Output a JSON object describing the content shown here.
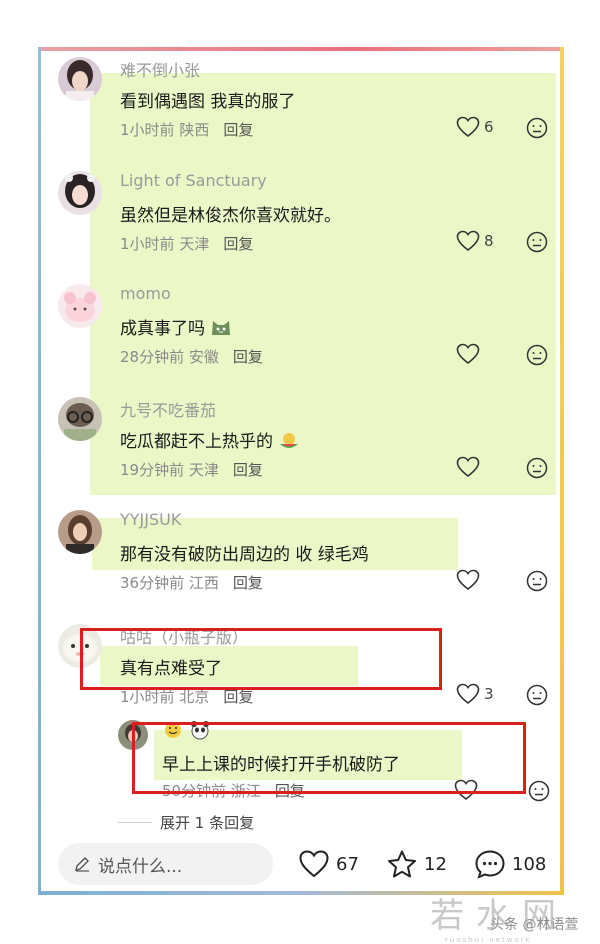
{
  "colors": {
    "highlight": "#ecf7c8",
    "annotation_red": "#d9201e",
    "frame_top": "#e86f7d",
    "frame_left": "#7ab2cf",
    "frame_right": "#f1c24a"
  },
  "comments": [
    {
      "username": "难不倒小张",
      "text": "看到偶遇图 我真的服了",
      "time": "1小时前",
      "location": "陕西",
      "reply_label": "回复",
      "likes": "6"
    },
    {
      "username": "Light of Sanctuary",
      "text": "虽然但是林俊杰你喜欢就好。",
      "time": "1小时前",
      "location": "天津",
      "reply_label": "回复",
      "likes": "8"
    },
    {
      "username": "momo",
      "text": "成真事了吗",
      "time": "28分钟前",
      "location": "安徽",
      "reply_label": "回复",
      "likes": ""
    },
    {
      "username": "九号不吃番茄",
      "text": "吃瓜都赶不上热乎的",
      "time": "19分钟前",
      "location": "天津",
      "reply_label": "回复",
      "likes": ""
    },
    {
      "username": "YYJJSUK",
      "text": "那有没有破防出周边的 收 绿毛鸡",
      "time": "36分钟前",
      "location": "江西",
      "reply_label": "回复",
      "likes": ""
    },
    {
      "username": "咕咕（小瓶子版）",
      "text": "真有点难受了",
      "time": "1小时前",
      "location": "北京",
      "reply_label": "回复",
      "likes": "3"
    }
  ],
  "subreply": {
    "text": "早上上课的时候打开手机破防了",
    "time": "50分钟前",
    "location": "浙江",
    "reply_label": "回复"
  },
  "expand_label": "展开 1 条回复",
  "bottom_bar": {
    "placeholder": "说点什么...",
    "likes": "67",
    "stars": "12",
    "comments": "108"
  },
  "watermark": {
    "site": "若水网",
    "credit": "头条 @林语萱",
    "sub": "ruoshui network"
  },
  "icons": {
    "like": "heart-outline-icon",
    "dislike": "neutral-face-icon",
    "edit": "pencil-icon",
    "star": "star-outline-icon",
    "comment": "chat-bubble-icon"
  }
}
